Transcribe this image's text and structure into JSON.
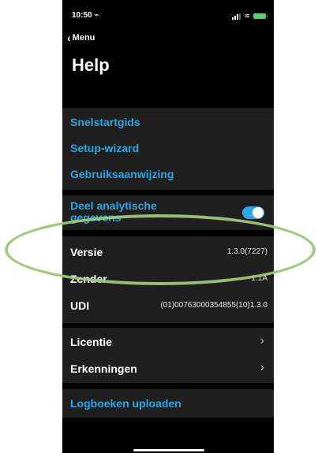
{
  "status": {
    "time": "10:50 ⌁"
  },
  "nav": {
    "back_label": "Menu",
    "title": "Help"
  },
  "links": [
    "Snelstartgids",
    "Setup-wizard",
    "Gebruiksaanwijzing"
  ],
  "analytics": {
    "label_line1": "Deel analytische",
    "label_line2": "gegevens",
    "toggle_on": true
  },
  "info": {
    "versie": {
      "label": "Versie",
      "value": "1.3.0(7227)"
    },
    "zender": {
      "label": "Zender",
      "value": "1.1A"
    },
    "udi": {
      "label": "UDI",
      "value": "(01)00763000354855(10)1.3.0"
    }
  },
  "more": {
    "licentie": "Licentie",
    "erkenningen": "Erkenningen"
  },
  "upload": {
    "label": "Logboeken uploaden"
  },
  "colors": {
    "accent": "#2aa7e6",
    "highlight": "#9dc87a",
    "background": "#000000",
    "cell": "#1f1f1f"
  }
}
